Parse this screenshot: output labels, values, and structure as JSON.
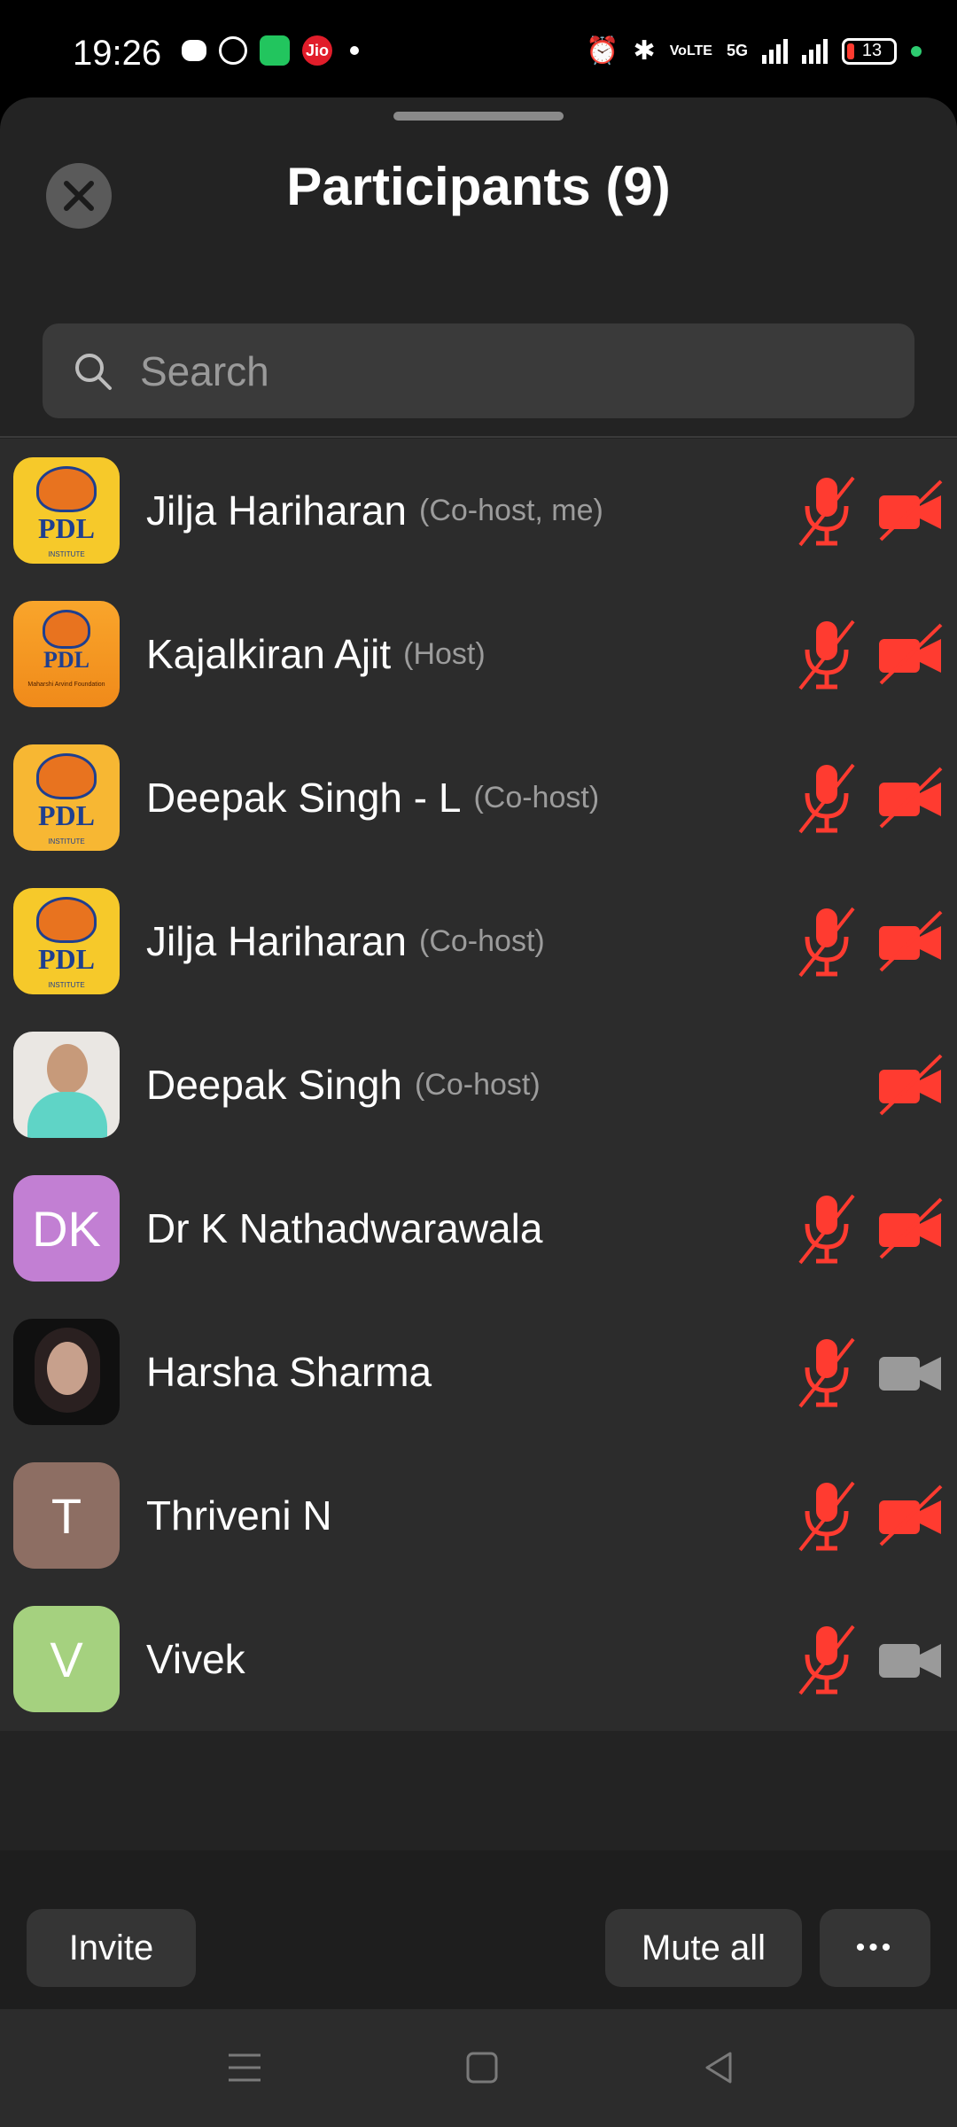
{
  "status_bar": {
    "time": "19:26",
    "battery": "13",
    "network": "5G",
    "carrier_badge": "Jio",
    "volte": "VoLTE"
  },
  "sheet": {
    "title": "Participants (9)",
    "close_icon": "close-icon"
  },
  "search": {
    "placeholder": "Search",
    "icon": "search-icon"
  },
  "participants": [
    {
      "name": "Jilja Hariharan",
      "role": "(Co-host, me)",
      "avatar": "pdl-logo",
      "mic": "muted",
      "video": "off"
    },
    {
      "name": "Kajalkiran Ajit",
      "role": "(Host)",
      "avatar": "maharshi-logo",
      "mic": "muted",
      "video": "off"
    },
    {
      "name": "Deepak Singh - L",
      "role": "(Co-host)",
      "avatar": "pdl-logo",
      "mic": "muted",
      "video": "off"
    },
    {
      "name": "Jilja Hariharan",
      "role": "(Co-host)",
      "avatar": "pdl-logo",
      "mic": "muted",
      "video": "off"
    },
    {
      "name": "Deepak Singh",
      "role": "(Co-host)",
      "avatar": "photo",
      "mic": "none",
      "video": "off"
    },
    {
      "name": "Dr K Nathadwarawala",
      "role": "",
      "avatar": "DK",
      "avatar_color": "#c27fd3",
      "mic": "muted",
      "video": "off"
    },
    {
      "name": "Harsha Sharma",
      "role": "",
      "avatar": "photo",
      "mic": "muted",
      "video": "on"
    },
    {
      "name": "Thriveni N",
      "role": "",
      "avatar": "T",
      "avatar_color": "#8d6e63",
      "mic": "muted",
      "video": "off"
    },
    {
      "name": "Vivek",
      "role": "",
      "avatar": "V",
      "avatar_color": "#a5d17f",
      "mic": "muted",
      "video": "on"
    }
  ],
  "avatar_text": {
    "pdl": "PDL",
    "pdl_sub": "INSTITUTE",
    "maharshi": "Maharshi Arvind Foundation"
  },
  "footer": {
    "invite_label": "Invite",
    "mute_all_label": "Mute all",
    "more_label": "•••"
  },
  "colors": {
    "muted_red": "#ff3b30",
    "video_on_gray": "#9a9a9a",
    "sheet_bg": "#232323",
    "list_bg": "#2c2c2c"
  }
}
